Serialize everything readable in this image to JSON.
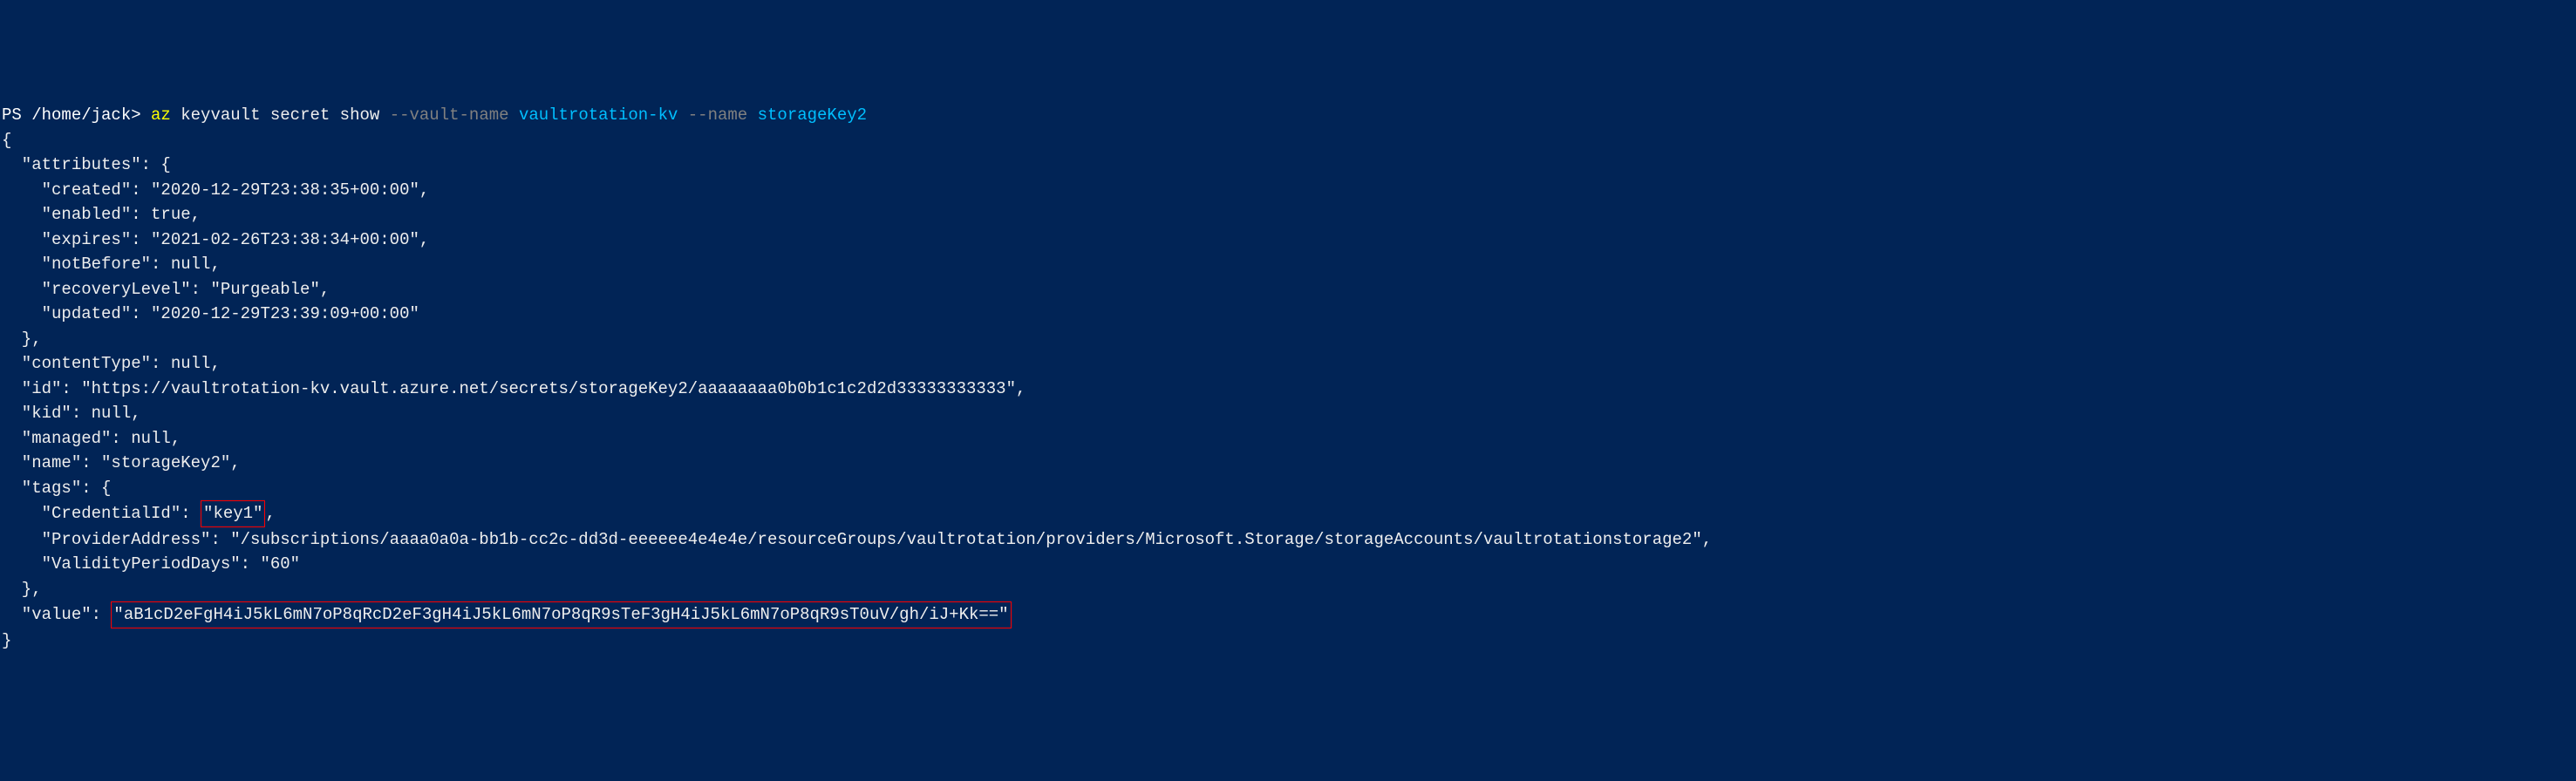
{
  "prompt": {
    "prefix": "PS /home/jack> ",
    "cmd": "az ",
    "subcmd": "keyvault secret show ",
    "param1": "--vault-name ",
    "arg1": "vaultrotation-kv ",
    "param2": "--name ",
    "arg2": "storageKey2"
  },
  "output": {
    "line1": "{",
    "line2": "  \"attributes\": {",
    "line3": "    \"created\": \"2020-12-29T23:38:35+00:00\",",
    "line4": "    \"enabled\": true,",
    "line5": "    \"expires\": \"2021-02-26T23:38:34+00:00\",",
    "line6": "    \"notBefore\": null,",
    "line7": "    \"recoveryLevel\": \"Purgeable\",",
    "line8": "    \"updated\": \"2020-12-29T23:39:09+00:00\"",
    "line9": "  },",
    "line10": "  \"contentType\": null,",
    "line11": "  \"id\": \"https://vaultrotation-kv.vault.azure.net/secrets/storageKey2/aaaaaaaa0b0b1c1c2d2d33333333333\",",
    "line12": "  \"kid\": null,",
    "line13": "  \"managed\": null,",
    "line14": "  \"name\": \"storageKey2\",",
    "line15": "  \"tags\": {",
    "line16a": "    \"CredentialId\": ",
    "line16b": "\"key1\"",
    "line16c": ",",
    "line17": "    \"ProviderAddress\": \"/subscriptions/aaaa0a0a-bb1b-cc2c-dd3d-eeeeee4e4e4e/resourceGroups/vaultrotation/providers/Microsoft.Storage/storageAccounts/vaultrotationstorage2\",",
    "line18": "    \"ValidityPeriodDays\": \"60\"",
    "line19": "  },",
    "line20a": "  \"value\": ",
    "line20b": "\"aB1cD2eFgH4iJ5kL6mN7oP8qRcD2eF3gH4iJ5kL6mN7oP8qR9sTeF3gH4iJ5kL6mN7oP8qR9sT0uV/gh/iJ+Kk==\"",
    "line21": "}"
  }
}
